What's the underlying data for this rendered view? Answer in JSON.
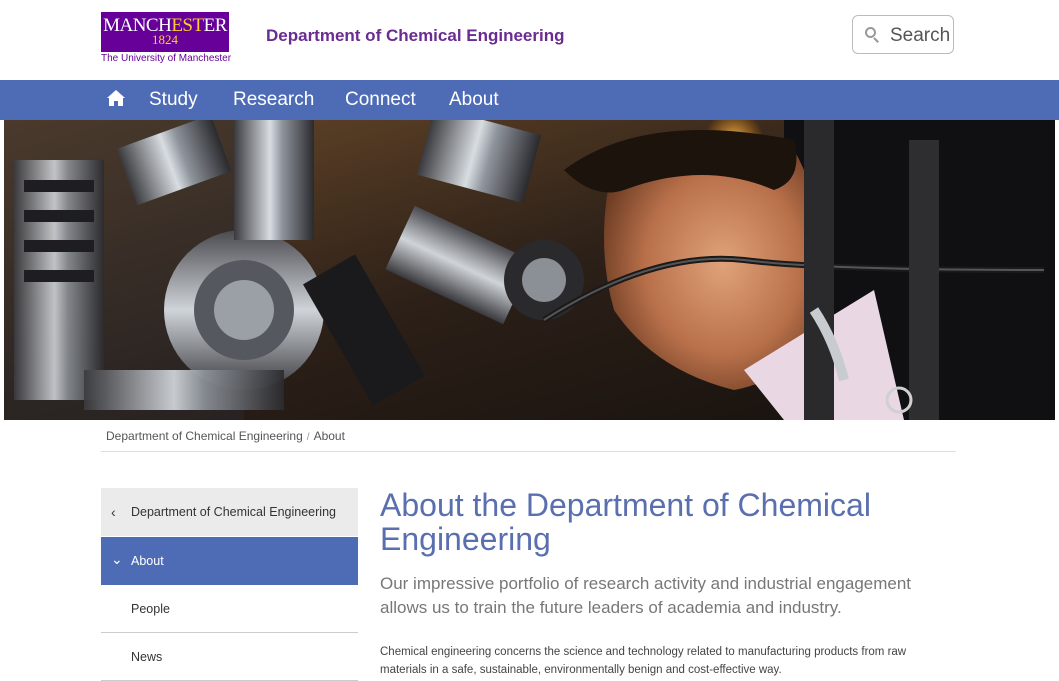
{
  "header": {
    "logo_word_before": "MANCH",
    "logo_word_gold": "EST",
    "logo_word_after": "ER",
    "logo_year": "1824",
    "logo_subtitle": "The University of Manchester",
    "department_title": "Department of Chemical Engineering",
    "search_label": "Search"
  },
  "nav": {
    "home_icon": "home-icon",
    "items": [
      {
        "label": "Study"
      },
      {
        "label": "Research"
      },
      {
        "label": "Connect"
      },
      {
        "label": "About"
      }
    ]
  },
  "colors": {
    "brand_purple": "#660099",
    "brand_gold": "#ffcc33",
    "nav_blue": "#4e6cb6",
    "title_blue": "#5a6fae"
  },
  "breadcrumb": {
    "items": [
      "Department of Chemical Engineering",
      "About"
    ],
    "separator": "/"
  },
  "sidebar": {
    "parent": {
      "label": "Department of Chemical Engineering",
      "icon": "chevron-left-icon"
    },
    "active": {
      "label": "About",
      "icon": "chevron-down-icon"
    },
    "items": [
      {
        "label": "People"
      },
      {
        "label": "News"
      }
    ]
  },
  "main": {
    "title": "About the Department of Chemical Engineering",
    "lead": "Our impressive portfolio of research activity and industrial engagement allows us to train the future leaders of academia and industry.",
    "body": "Chemical engineering concerns the science and technology related to manufacturing products from raw materials in a safe, sustainable, environmentally benign and cost-effective way."
  }
}
